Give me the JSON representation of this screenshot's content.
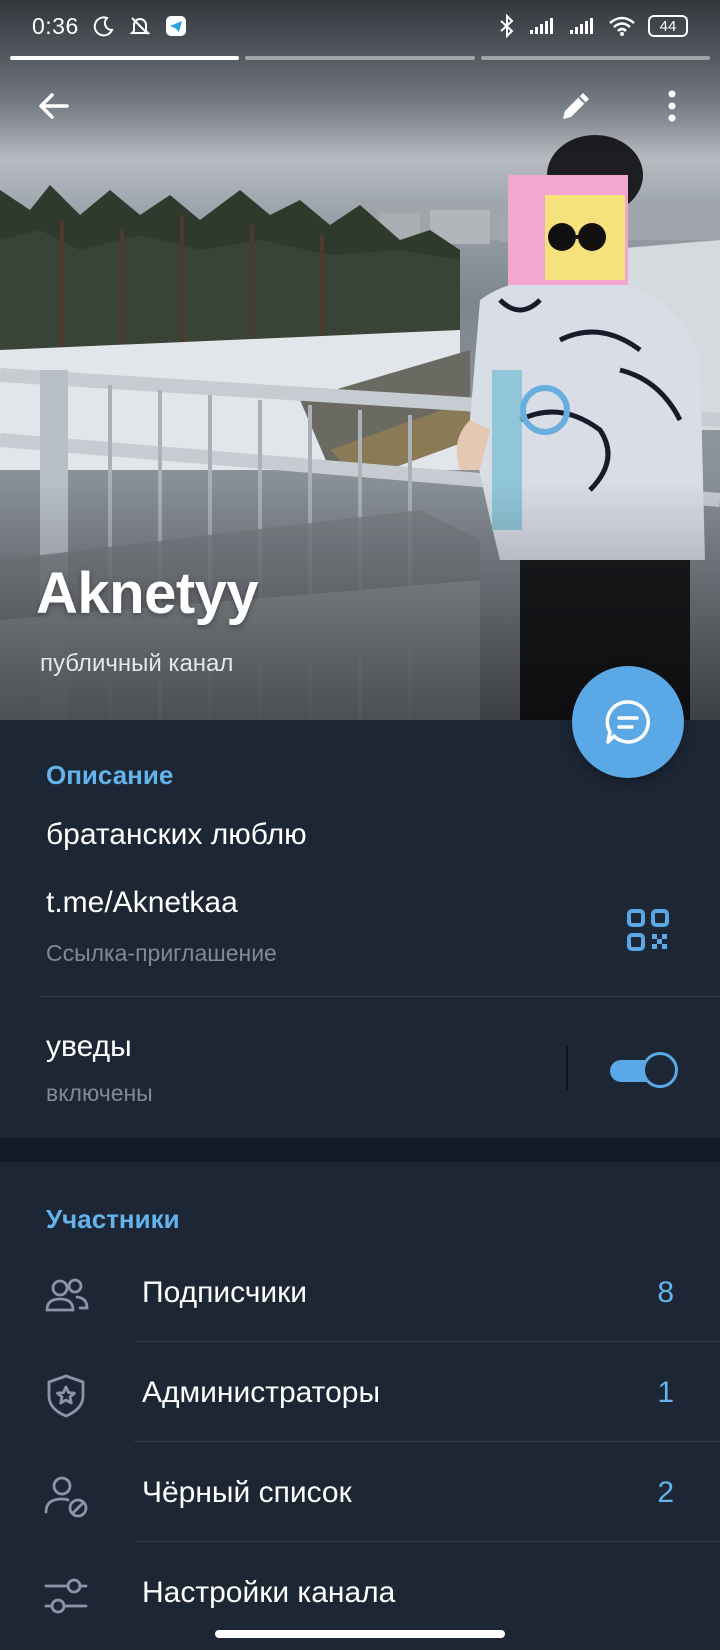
{
  "status_bar": {
    "time": "0:36",
    "battery": "44"
  },
  "story_progress": {
    "segments": 3,
    "active_index": 0
  },
  "channel": {
    "name": "Aknetyy",
    "subtitle": "публичный канал"
  },
  "info": {
    "section_title": "Описание",
    "description": "братанских люблю",
    "link": "t.me/Aknetkaa",
    "link_caption": "Ссылка-приглашение",
    "notifications_label": "уведы",
    "notifications_state": "включены",
    "notifications_on": true
  },
  "members": {
    "section_title": "Участники",
    "items": [
      {
        "label": "Подписчики",
        "count": "8",
        "icon": "users-icon"
      },
      {
        "label": "Администраторы",
        "count": "1",
        "icon": "shield-star-icon"
      },
      {
        "label": "Чёрный список",
        "count": "2",
        "icon": "user-blocked-icon"
      },
      {
        "label": "Настройки канала",
        "count": "",
        "icon": "settings-sliders-icon"
      }
    ]
  },
  "colors": {
    "accent": "#63b3ec",
    "fab": "#5aa9e6",
    "background": "#1d2635",
    "subtext": "#7f8a98"
  }
}
